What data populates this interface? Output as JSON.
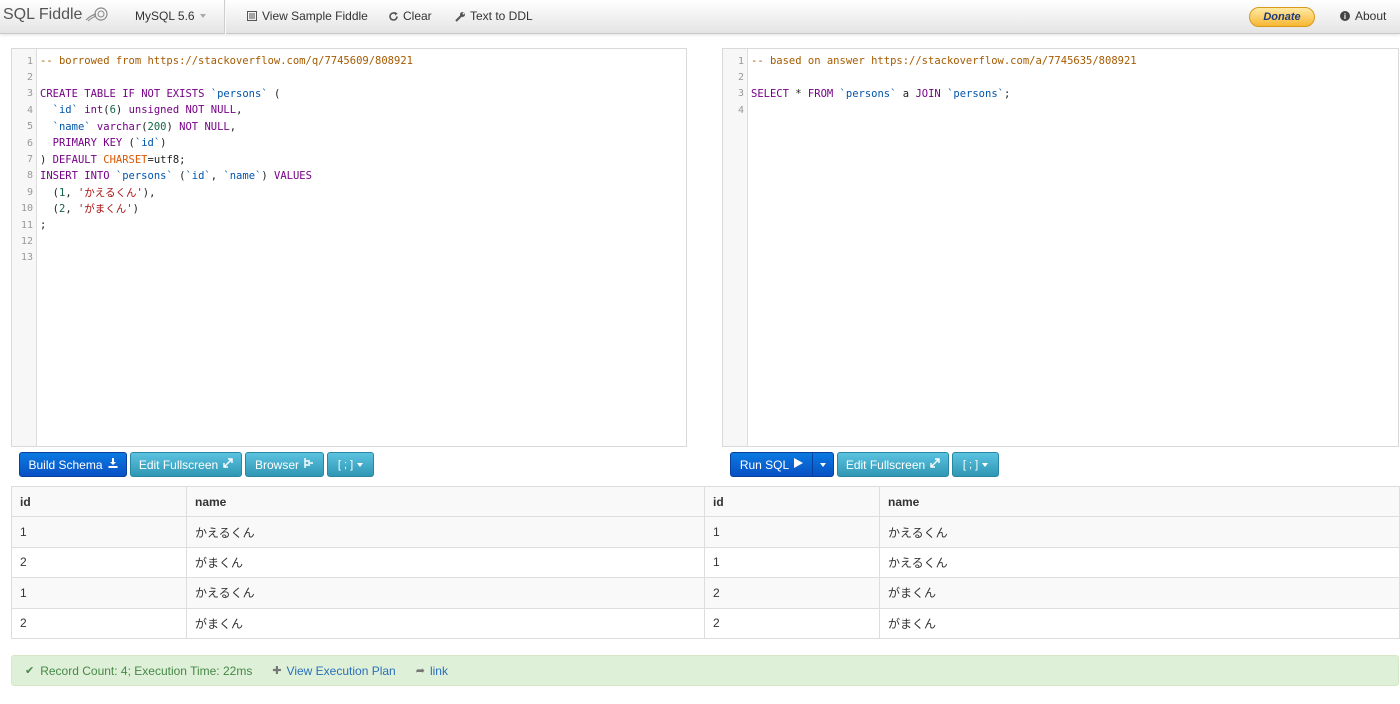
{
  "navbar": {
    "brand": "SQL Fiddle",
    "db_version": "MySQL 5.6",
    "view_sample": "View Sample Fiddle",
    "clear": "Clear",
    "text_to_ddl": "Text to DDL",
    "donate": "Donate",
    "about": "About"
  },
  "schema_editor": {
    "lines": [
      [
        "1",
        "-- borrowed from https://stackoverflow.com/q/7745609/808921"
      ],
      [
        "2",
        ""
      ],
      [
        "3",
        "CREATE TABLE IF NOT EXISTS `persons` ("
      ],
      [
        "4",
        "  `id` int(6) unsigned NOT NULL,"
      ],
      [
        "5",
        "  `name` varchar(200) NOT NULL,"
      ],
      [
        "6",
        "  PRIMARY KEY (`id`)"
      ],
      [
        "7",
        ") DEFAULT CHARSET=utf8;"
      ],
      [
        "8",
        "INSERT INTO `persons` (`id`, `name`) VALUES"
      ],
      [
        "9",
        "  (1, 'かえるくん'),"
      ],
      [
        "10",
        "  (2, 'がまくん')"
      ],
      [
        "11",
        ";"
      ],
      [
        "12",
        ""
      ],
      [
        "13",
        ""
      ]
    ]
  },
  "query_editor": {
    "lines": [
      [
        "1",
        "-- based on answer https://stackoverflow.com/a/7745635/808921"
      ],
      [
        "2",
        ""
      ],
      [
        "3",
        "SELECT * FROM `persons` a JOIN `persons`;"
      ],
      [
        "4",
        ""
      ]
    ]
  },
  "schema_toolbar": {
    "build_schema": "Build Schema",
    "edit_fullscreen": "Edit Fullscreen",
    "browser": "Browser",
    "terminator": "[ ; ]"
  },
  "query_toolbar": {
    "run_sql": "Run SQL",
    "edit_fullscreen": "Edit Fullscreen",
    "terminator": "[ ; ]"
  },
  "results": {
    "columns": [
      "id",
      "name",
      "id",
      "name"
    ],
    "rows": [
      [
        "1",
        "かえるくん",
        "1",
        "かえるくん"
      ],
      [
        "2",
        "がまくん",
        "1",
        "かえるくん"
      ],
      [
        "1",
        "かえるくん",
        "2",
        "がまくん"
      ],
      [
        "2",
        "がまくん",
        "2",
        "がまくん"
      ]
    ]
  },
  "status": {
    "message": "Record Count: 4; Execution Time: 22ms",
    "view_plan": "View Execution Plan",
    "link": "link"
  },
  "colors": {
    "primary": "#0950c5",
    "info": "#2f96b4",
    "success_bg": "#dff0d8",
    "success_text": "#468847"
  }
}
